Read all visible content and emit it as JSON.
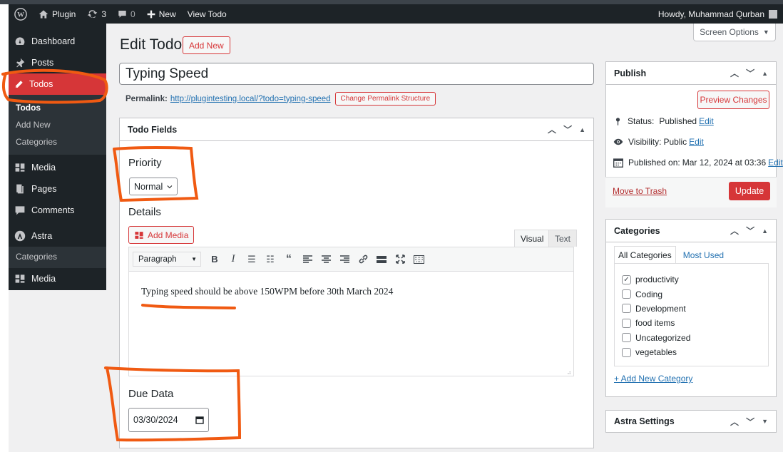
{
  "adminbar": {
    "site_name": "Plugin",
    "updates_count": "3",
    "comments_count": "0",
    "new_label": "New",
    "view_label": "View Todo",
    "howdy": "Howdy, Muhammad Qurban"
  },
  "sidebar": {
    "items": [
      {
        "label": "Dashboard",
        "icon": "dashboard-icon"
      },
      {
        "label": "Posts",
        "icon": "pin-icon"
      },
      {
        "label": "Todos",
        "icon": "pencil-icon"
      }
    ],
    "todos_sub": [
      "Todos",
      "Add New",
      "Categories"
    ],
    "items_after": [
      {
        "label": "Media",
        "icon": "media-icon"
      },
      {
        "label": "Pages",
        "icon": "pages-icon"
      },
      {
        "label": "Comments",
        "icon": "comments-icon"
      },
      {
        "label": "Astra",
        "icon": "astra-icon"
      }
    ],
    "astra_sub": [
      "Categories"
    ],
    "last_item": {
      "label": "Media",
      "icon": "media-icon"
    }
  },
  "screen_options": "Screen Options",
  "header": {
    "title": "Edit Todo",
    "add_new": "Add New"
  },
  "post": {
    "title": "Typing Speed",
    "permalink_label": "Permalink:",
    "permalink_url": "http://plugintesting.local/?todo=typing-speed",
    "change_permalink": "Change Permalink Structure"
  },
  "todo_fields": {
    "header": "Todo Fields",
    "priority_label": "Priority",
    "priority_value": "Normal",
    "details_label": "Details",
    "add_media": "Add Media",
    "tab_visual": "Visual",
    "tab_text": "Text",
    "format_select": "Paragraph",
    "content": "Typing speed should be above 150WPM before 30th March 2024",
    "due_label": "Due Data",
    "due_value": "03/30/2024"
  },
  "publish": {
    "header": "Publish",
    "preview": "Preview Changes",
    "status_label": "Status:",
    "status_value": "Published",
    "visibility_label": "Visibility:",
    "visibility_value": "Public",
    "published_label": "Published on:",
    "published_value": "Mar 12, 2024 at 03:36",
    "edit": "Edit",
    "trash": "Move to Trash",
    "update": "Update"
  },
  "categories": {
    "header": "Categories",
    "tab_all": "All Categories",
    "tab_used": "Most Used",
    "items": [
      {
        "label": "productivity",
        "checked": true
      },
      {
        "label": "Coding",
        "checked": false
      },
      {
        "label": "Development",
        "checked": false
      },
      {
        "label": "food items",
        "checked": false
      },
      {
        "label": "Uncategorized",
        "checked": false
      },
      {
        "label": "vegetables",
        "checked": false
      }
    ],
    "add_new": "+ Add New Category"
  },
  "astra_settings": {
    "header": "Astra Settings"
  },
  "colors": {
    "accent": "#d63638",
    "annotation": "#f05a12",
    "adminbar": "#1d2327",
    "link": "#2271b1"
  }
}
